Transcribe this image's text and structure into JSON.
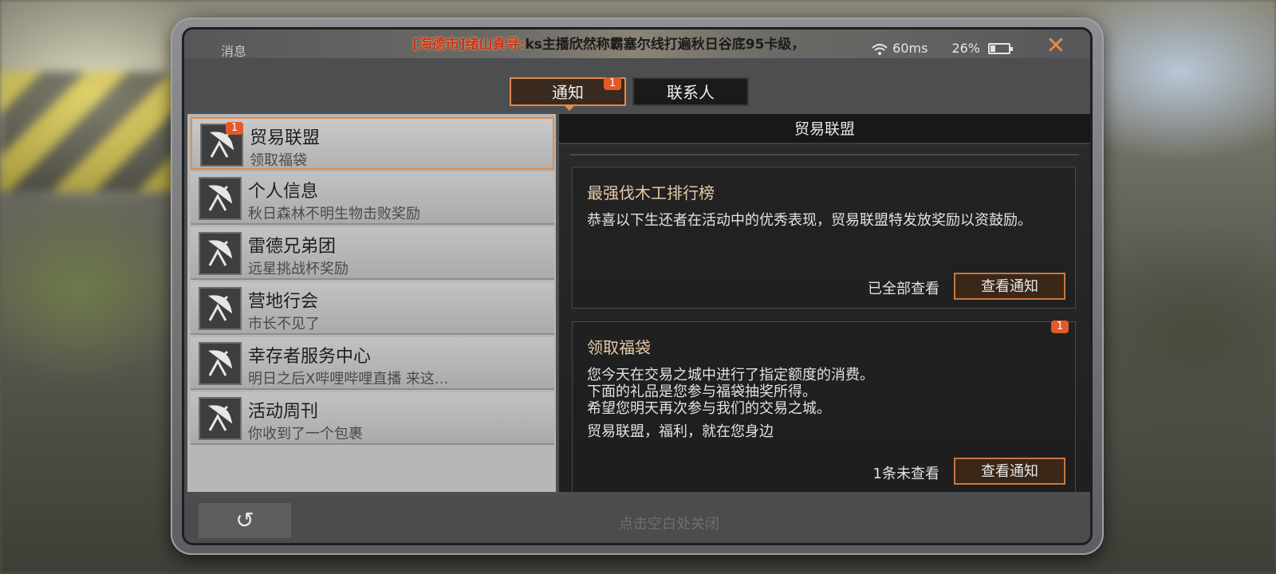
{
  "header": {
    "title": "消息",
    "ticker_highlight": "[海德市]绪山真寻:",
    "ticker_text": "ks主播欣然称霸塞尔线打遍秋日谷底95卡级，",
    "latency": "60ms",
    "battery": "26%",
    "battery_level": 0.26,
    "close_icon": "close-icon"
  },
  "tabs": [
    {
      "label": "通知",
      "badge": "1",
      "active": true
    },
    {
      "label": "联系人",
      "badge": "",
      "active": false
    }
  ],
  "list": [
    {
      "name": "贸易联盟",
      "desc": "领取福袋",
      "badge": "1",
      "active": true
    },
    {
      "name": "个人信息",
      "desc": "秋日森林不明生物击败奖励",
      "badge": ""
    },
    {
      "name": "雷德兄弟团",
      "desc": "远星挑战杯奖励",
      "badge": ""
    },
    {
      "name": "营地行会",
      "desc": "市长不见了",
      "badge": ""
    },
    {
      "name": "幸存者服务中心",
      "desc": "明日之后X哔哩哔哩直播 来这...",
      "badge": ""
    },
    {
      "name": "活动周刊",
      "desc": "你收到了一个包裹",
      "badge": ""
    }
  ],
  "panel": {
    "header": "贸易联盟",
    "cards": [
      {
        "title": "最强伐木工排行榜",
        "body": [
          "恭喜以下生还者在活动中的优秀表现，贸易联盟特发放奖励以资鼓励。"
        ],
        "status": "已全部查看",
        "button": "查看通知",
        "badge": ""
      },
      {
        "title": "领取福袋",
        "body": [
          "您今天在交易之城中进行了指定额度的消费。",
          "下面的礼品是您参与福袋抽奖所得。",
          "希望您明天再次参与我们的交易之城。"
        ],
        "footer_line": "贸易联盟，福利，就在您身边",
        "status": "1条未查看",
        "button": "查看通知",
        "badge": "1"
      }
    ]
  },
  "bottom": {
    "back_icon": "back-arrow-icon",
    "close_hint": "点击空白处关闭"
  },
  "colors": {
    "accent": "#e28a4a",
    "badge": "#e25a2a"
  }
}
